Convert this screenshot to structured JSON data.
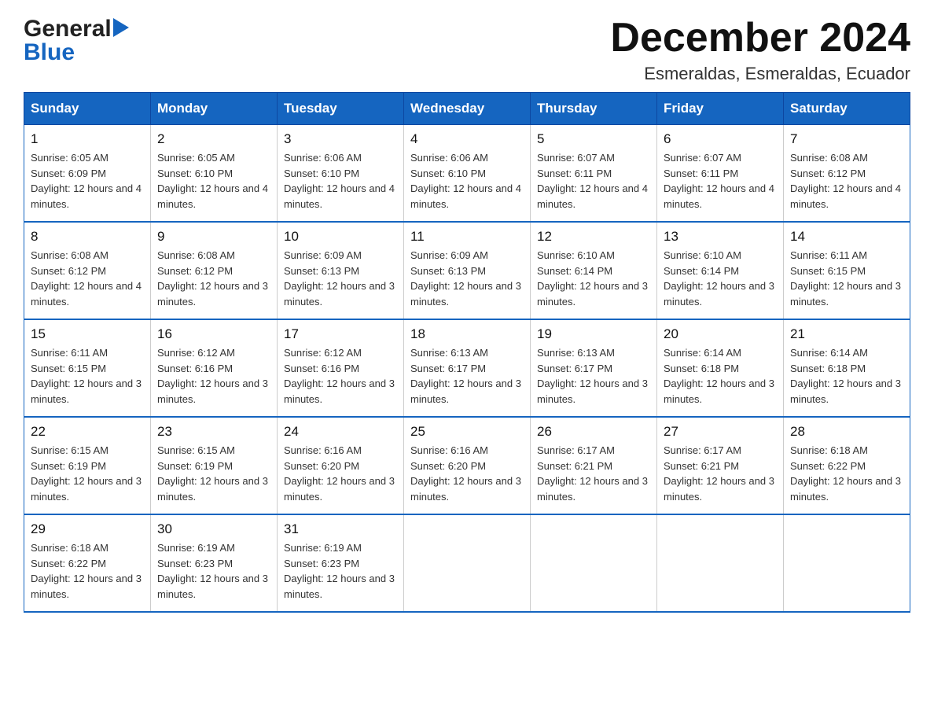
{
  "header": {
    "month_title": "December 2024",
    "location": "Esmeraldas, Esmeraldas, Ecuador",
    "logo_general": "General",
    "logo_blue": "Blue"
  },
  "days_of_week": [
    "Sunday",
    "Monday",
    "Tuesday",
    "Wednesday",
    "Thursday",
    "Friday",
    "Saturday"
  ],
  "weeks": [
    [
      {
        "day": "1",
        "sunrise": "6:05 AM",
        "sunset": "6:09 PM",
        "daylight": "12 hours and 4 minutes."
      },
      {
        "day": "2",
        "sunrise": "6:05 AM",
        "sunset": "6:10 PM",
        "daylight": "12 hours and 4 minutes."
      },
      {
        "day": "3",
        "sunrise": "6:06 AM",
        "sunset": "6:10 PM",
        "daylight": "12 hours and 4 minutes."
      },
      {
        "day": "4",
        "sunrise": "6:06 AM",
        "sunset": "6:10 PM",
        "daylight": "12 hours and 4 minutes."
      },
      {
        "day": "5",
        "sunrise": "6:07 AM",
        "sunset": "6:11 PM",
        "daylight": "12 hours and 4 minutes."
      },
      {
        "day": "6",
        "sunrise": "6:07 AM",
        "sunset": "6:11 PM",
        "daylight": "12 hours and 4 minutes."
      },
      {
        "day": "7",
        "sunrise": "6:08 AM",
        "sunset": "6:12 PM",
        "daylight": "12 hours and 4 minutes."
      }
    ],
    [
      {
        "day": "8",
        "sunrise": "6:08 AM",
        "sunset": "6:12 PM",
        "daylight": "12 hours and 4 minutes."
      },
      {
        "day": "9",
        "sunrise": "6:08 AM",
        "sunset": "6:12 PM",
        "daylight": "12 hours and 3 minutes."
      },
      {
        "day": "10",
        "sunrise": "6:09 AM",
        "sunset": "6:13 PM",
        "daylight": "12 hours and 3 minutes."
      },
      {
        "day": "11",
        "sunrise": "6:09 AM",
        "sunset": "6:13 PM",
        "daylight": "12 hours and 3 minutes."
      },
      {
        "day": "12",
        "sunrise": "6:10 AM",
        "sunset": "6:14 PM",
        "daylight": "12 hours and 3 minutes."
      },
      {
        "day": "13",
        "sunrise": "6:10 AM",
        "sunset": "6:14 PM",
        "daylight": "12 hours and 3 minutes."
      },
      {
        "day": "14",
        "sunrise": "6:11 AM",
        "sunset": "6:15 PM",
        "daylight": "12 hours and 3 minutes."
      }
    ],
    [
      {
        "day": "15",
        "sunrise": "6:11 AM",
        "sunset": "6:15 PM",
        "daylight": "12 hours and 3 minutes."
      },
      {
        "day": "16",
        "sunrise": "6:12 AM",
        "sunset": "6:16 PM",
        "daylight": "12 hours and 3 minutes."
      },
      {
        "day": "17",
        "sunrise": "6:12 AM",
        "sunset": "6:16 PM",
        "daylight": "12 hours and 3 minutes."
      },
      {
        "day": "18",
        "sunrise": "6:13 AM",
        "sunset": "6:17 PM",
        "daylight": "12 hours and 3 minutes."
      },
      {
        "day": "19",
        "sunrise": "6:13 AM",
        "sunset": "6:17 PM",
        "daylight": "12 hours and 3 minutes."
      },
      {
        "day": "20",
        "sunrise": "6:14 AM",
        "sunset": "6:18 PM",
        "daylight": "12 hours and 3 minutes."
      },
      {
        "day": "21",
        "sunrise": "6:14 AM",
        "sunset": "6:18 PM",
        "daylight": "12 hours and 3 minutes."
      }
    ],
    [
      {
        "day": "22",
        "sunrise": "6:15 AM",
        "sunset": "6:19 PM",
        "daylight": "12 hours and 3 minutes."
      },
      {
        "day": "23",
        "sunrise": "6:15 AM",
        "sunset": "6:19 PM",
        "daylight": "12 hours and 3 minutes."
      },
      {
        "day": "24",
        "sunrise": "6:16 AM",
        "sunset": "6:20 PM",
        "daylight": "12 hours and 3 minutes."
      },
      {
        "day": "25",
        "sunrise": "6:16 AM",
        "sunset": "6:20 PM",
        "daylight": "12 hours and 3 minutes."
      },
      {
        "day": "26",
        "sunrise": "6:17 AM",
        "sunset": "6:21 PM",
        "daylight": "12 hours and 3 minutes."
      },
      {
        "day": "27",
        "sunrise": "6:17 AM",
        "sunset": "6:21 PM",
        "daylight": "12 hours and 3 minutes."
      },
      {
        "day": "28",
        "sunrise": "6:18 AM",
        "sunset": "6:22 PM",
        "daylight": "12 hours and 3 minutes."
      }
    ],
    [
      {
        "day": "29",
        "sunrise": "6:18 AM",
        "sunset": "6:22 PM",
        "daylight": "12 hours and 3 minutes."
      },
      {
        "day": "30",
        "sunrise": "6:19 AM",
        "sunset": "6:23 PM",
        "daylight": "12 hours and 3 minutes."
      },
      {
        "day": "31",
        "sunrise": "6:19 AM",
        "sunset": "6:23 PM",
        "daylight": "12 hours and 3 minutes."
      },
      null,
      null,
      null,
      null
    ]
  ]
}
